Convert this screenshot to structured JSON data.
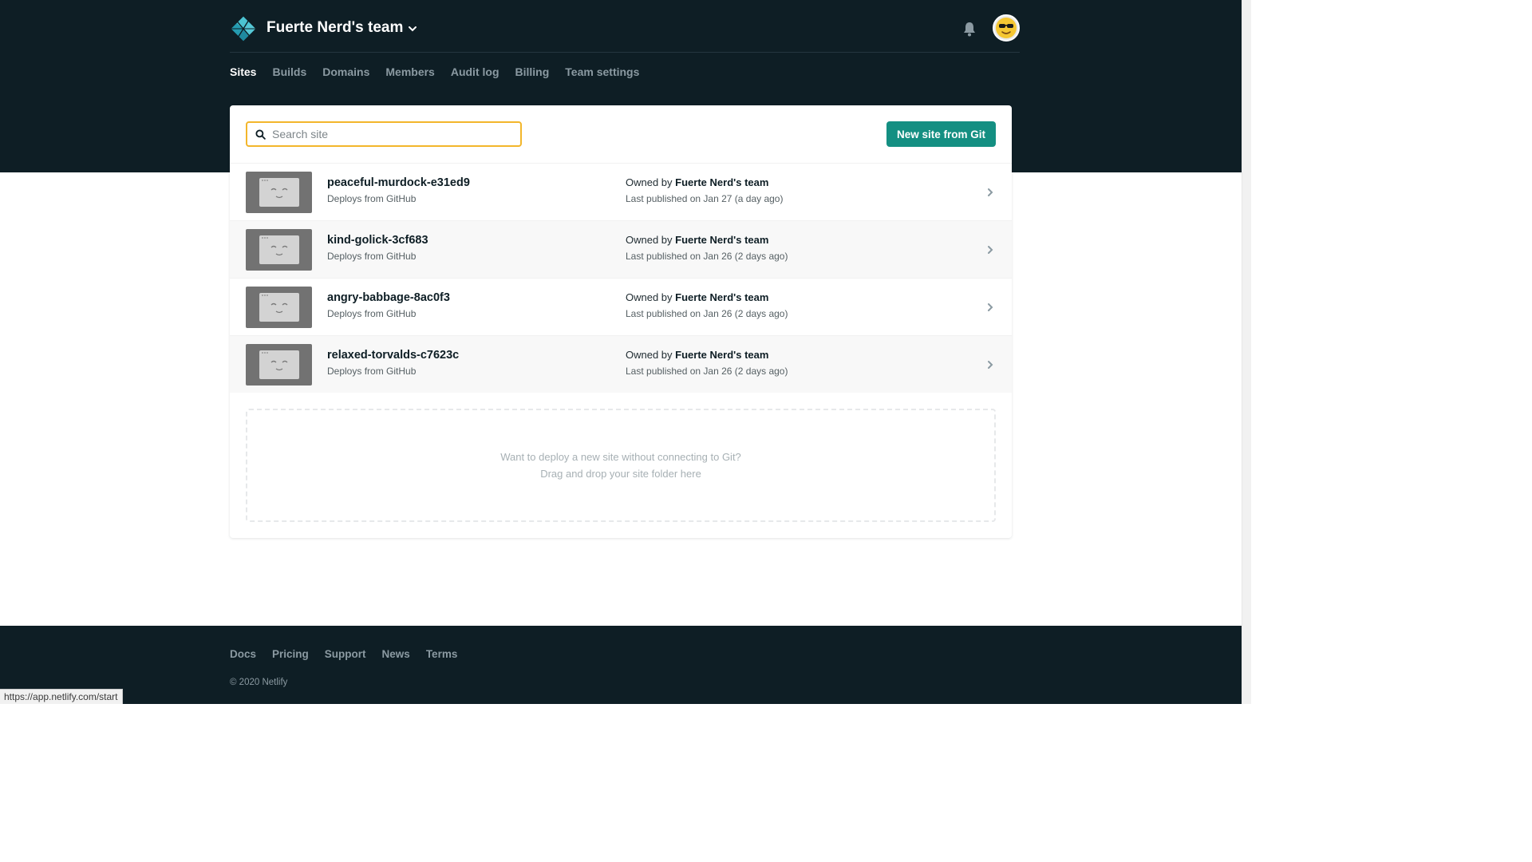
{
  "header": {
    "team_name": "Fuerte Nerd's team",
    "logo_icon": "netlify-logo-icon",
    "bell_icon": "bell-icon",
    "avatar_icon": "sunglasses-emoji-avatar"
  },
  "nav": {
    "items": [
      {
        "label": "Sites",
        "active": true
      },
      {
        "label": "Builds",
        "active": false
      },
      {
        "label": "Domains",
        "active": false
      },
      {
        "label": "Members",
        "active": false
      },
      {
        "label": "Audit log",
        "active": false
      },
      {
        "label": "Billing",
        "active": false
      },
      {
        "label": "Team settings",
        "active": false
      }
    ]
  },
  "search": {
    "placeholder": "Search site",
    "value": ""
  },
  "new_site_button": "New site from Git",
  "sites": [
    {
      "name": "peaceful-murdock-e31ed9",
      "deploy": "Deploys from GitHub",
      "owner_prefix": "Owned by",
      "owner": "Fuerte Nerd's team",
      "published": "Last published on Jan 27 (a day ago)"
    },
    {
      "name": "kind-golick-3cf683",
      "deploy": "Deploys from GitHub",
      "owner_prefix": "Owned by",
      "owner": "Fuerte Nerd's team",
      "published": "Last published on Jan 26 (2 days ago)"
    },
    {
      "name": "angry-babbage-8ac0f3",
      "deploy": "Deploys from GitHub",
      "owner_prefix": "Owned by",
      "owner": "Fuerte Nerd's team",
      "published": "Last published on Jan 26 (2 days ago)"
    },
    {
      "name": "relaxed-torvalds-c7623c",
      "deploy": "Deploys from GitHub",
      "owner_prefix": "Owned by",
      "owner": "Fuerte Nerd's team",
      "published": "Last published on Jan 26 (2 days ago)"
    }
  ],
  "dropzone": {
    "line1": "Want to deploy a new site without connecting to Git?",
    "line2": "Drag and drop your site folder here"
  },
  "footer": {
    "links": [
      "Docs",
      "Pricing",
      "Support",
      "News",
      "Terms"
    ],
    "copyright": "© 2020 Netlify"
  },
  "status_bar": {
    "url": "https://app.netlify.com/start"
  },
  "colors": {
    "header_bg": "#0e1e25",
    "accent_button": "#148f82",
    "search_focus": "#f3b62b"
  }
}
